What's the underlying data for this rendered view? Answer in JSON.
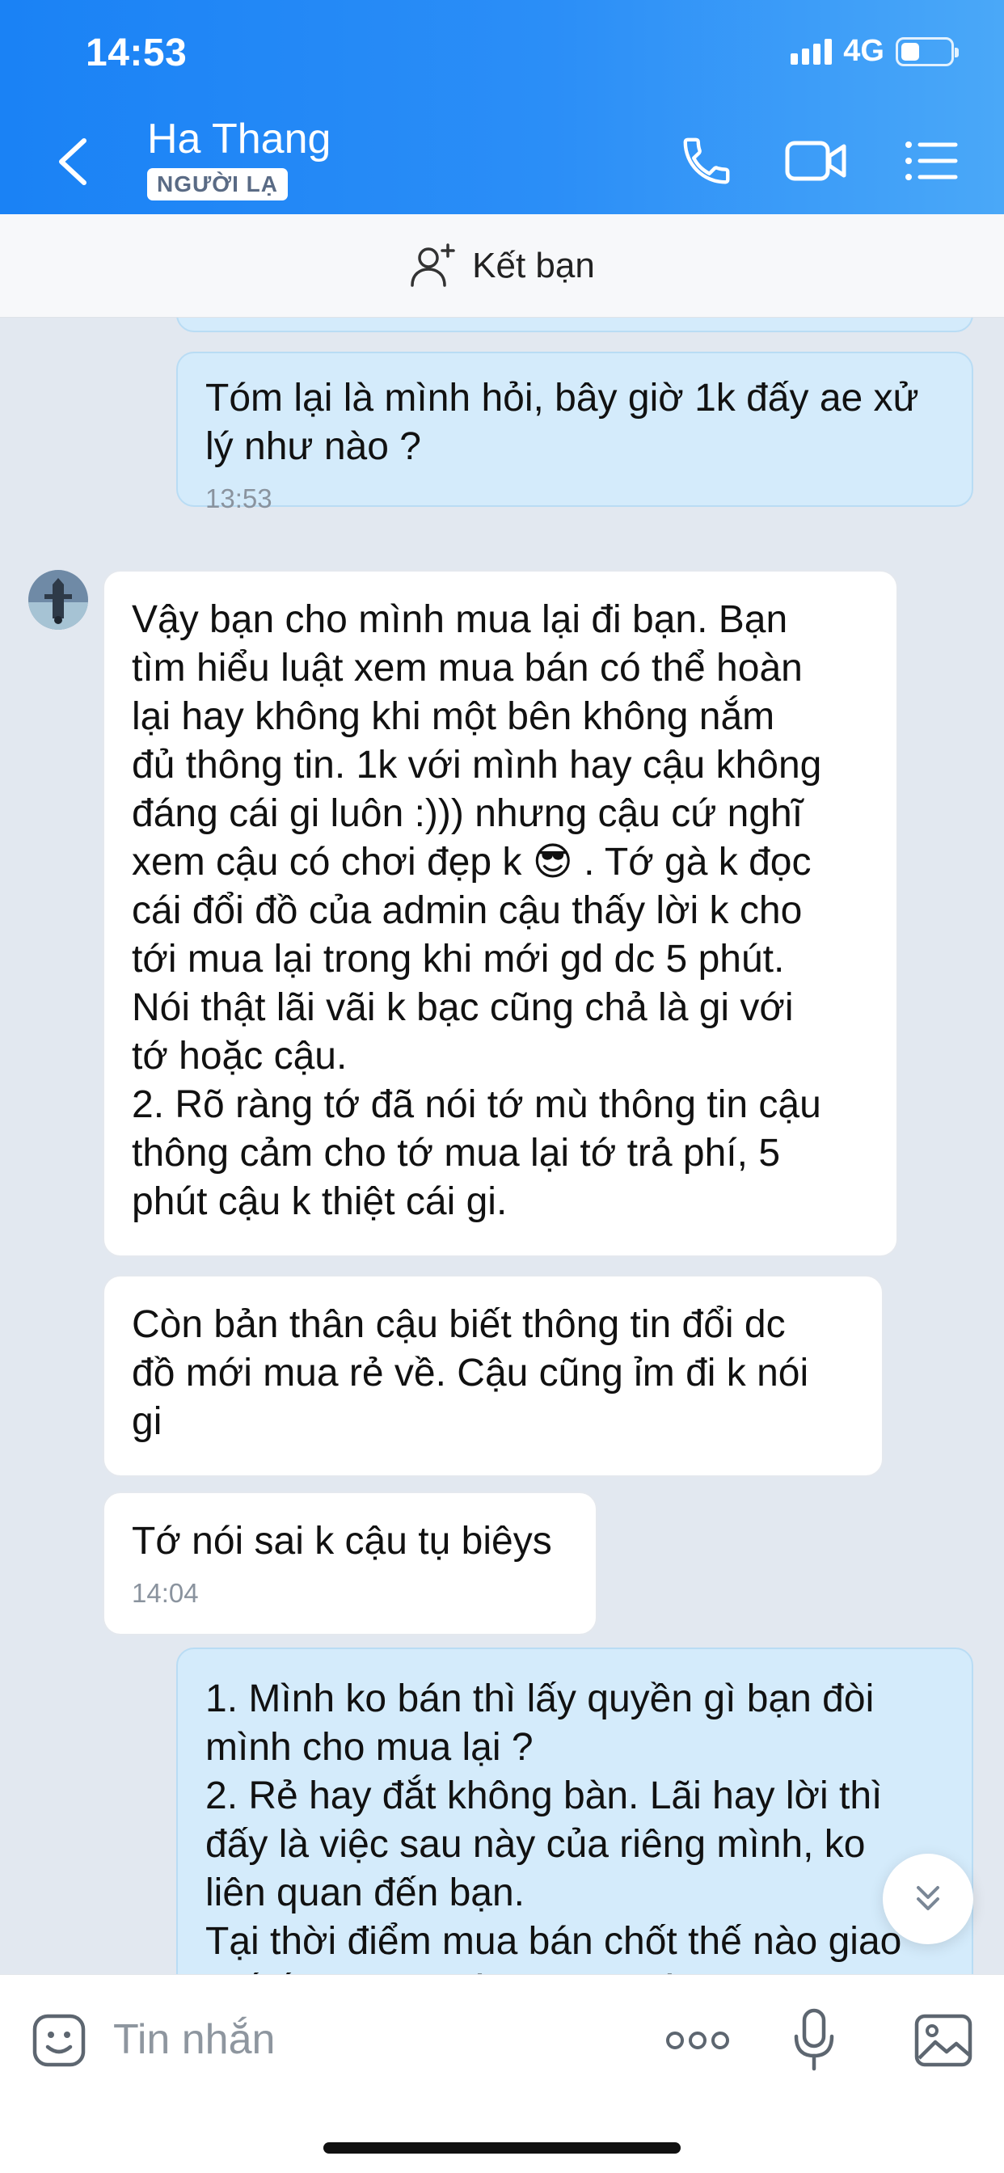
{
  "status_bar": {
    "time": "14:53",
    "network": "4G"
  },
  "header": {
    "contact_name": "Ha Thang",
    "badge": "NGƯỜI LẠ"
  },
  "friend_bar": {
    "label": "Kết bạn"
  },
  "messages": [
    {
      "direction": "out",
      "text": "Tóm lại là mình hỏi, bây giờ 1k đấy ae xử\nlý như nào ?",
      "time": "13:53"
    },
    {
      "direction": "in",
      "text": "Vậy bạn cho mình mua lại đi bạn. Bạn\ntìm hiểu luật xem mua bán có thể hoàn\nlại hay không khi một bên không nắm\nđủ thông tin. 1k với mình hay cậu không\nđáng cái gi luôn :))) nhưng cậu cứ nghĩ\nxem cậu có chơi đẹp k 😎 . Tớ gà k đọc\ncái đổi đồ của admin cậu thấy lời k cho\ntới mua lại trong khi mới gd dc 5 phút.\nNói thật lãi vãi k bạc cũng chả là gi với\ntớ hoặc cậu.\n2. Rõ ràng tớ đã nói tớ mù thông tin cậu\nthông cảm cho tớ mua lại tớ trả phí, 5\nphút cậu k thiệt cái gi."
    },
    {
      "direction": "in",
      "text": "Còn bản thân cậu biết thông tin đổi dc\nđồ mới mua rẻ về. Cậu cũng ỉm đi k nói\ngi"
    },
    {
      "direction": "in",
      "text": "Tớ nói sai k cậu tụ biêys",
      "time": "14:04"
    },
    {
      "direction": "out",
      "text": "1. Mình ko bán thì lấy quyền gì bạn đòi\nmình cho mua lại ?\n2. Rẻ hay đắt không bàn. Lãi hay lời thì\nđấy là việc sau này của riêng mình, ko\nliên quan đến bạn.\nTại thời điểm mua bán chốt thế nào giao\nthế ấy, không có chuyện nói lại."
    }
  ],
  "input": {
    "placeholder": "Tin nhắn"
  },
  "colors": {
    "header_start": "#1a82f5",
    "header_end": "#4aa8f8",
    "outgoing_bubble": "#d4ebfb",
    "incoming_bubble": "#ffffff",
    "chat_bg": "#e2e8f0"
  },
  "icons": [
    "chevron-left-icon",
    "phone-icon",
    "video-call-icon",
    "list-menu-icon",
    "add-friend-icon",
    "chevron-double-down-icon",
    "sticker-icon",
    "more-icon",
    "microphone-icon",
    "image-icon"
  ]
}
